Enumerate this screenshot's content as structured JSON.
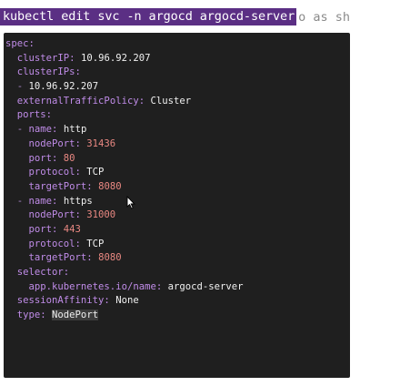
{
  "command": {
    "text": "kubectl edit svc -n argocd argocd-server",
    "trailing": "o as sh",
    "accent": "#5b2f84"
  },
  "terminal": {
    "background": "#1f1f1f",
    "lines": [
      {
        "key": "spec:"
      },
      {
        "key": "  clusterIP: ",
        "value": "10.96.92.207"
      },
      {
        "key": "  clusterIPs:"
      },
      {
        "key": "  - ",
        "value": "10.96.92.207"
      },
      {
        "key": "  externalTrafficPolicy: ",
        "value": "Cluster"
      },
      {
        "key": "  ports:"
      },
      {
        "key": "  - name: ",
        "value": "http"
      },
      {
        "key": "    nodePort: ",
        "num": "31436"
      },
      {
        "key": "    port: ",
        "num": "80"
      },
      {
        "key": "    protocol: ",
        "value": "TCP"
      },
      {
        "key": "    targetPort: ",
        "num": "8080"
      },
      {
        "key": "  - name: ",
        "value": "https"
      },
      {
        "key": "    nodePort: ",
        "num": "31000"
      },
      {
        "key": "    port: ",
        "num": "443"
      },
      {
        "key": "    protocol: ",
        "value": "TCP"
      },
      {
        "key": "    targetPort: ",
        "num": "8080"
      },
      {
        "key": "  selector:"
      },
      {
        "key": "    app.kubernetes.io/name: ",
        "value": "argocd-server"
      },
      {
        "key": "  sessionAffinity: ",
        "value": "None"
      },
      {
        "key": "  type: ",
        "value": "NodePort",
        "highlight": true
      }
    ]
  }
}
